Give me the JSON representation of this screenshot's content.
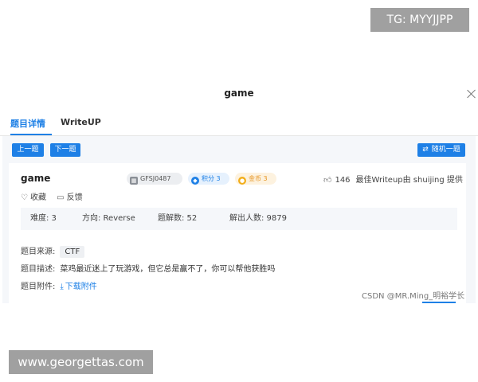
{
  "watermarks": {
    "top_right": "TG: MYYJJPP",
    "bottom_left": "www.georgettas.com",
    "csdn": "CSDN @MR.Ming_明裕学长"
  },
  "modal": {
    "title": "game"
  },
  "tabs": [
    {
      "label": "题目详情",
      "active": true
    },
    {
      "label": "WriteUP",
      "active": false
    }
  ],
  "toolbar": {
    "prev_label": "上一题",
    "next_label": "下一题",
    "random_label": "随机一题"
  },
  "challenge": {
    "name": "game",
    "id_badge": "GFSJ0487",
    "points_badge": "积分 3",
    "gold_badge": "金币 3",
    "likes": "146",
    "best_writeup": "最佳Writeup由 shuijing 提供",
    "favorite_label": "收藏",
    "feedback_label": "反馈",
    "stats": {
      "difficulty": "难度:  3",
      "direction": "方向:  Reverse",
      "solves": "题解数:  52",
      "solvers": "解出人数:  9879"
    },
    "source_label": "题目来源:",
    "source_tag": "CTF",
    "description_label": "题目描述:",
    "description": "菜鸡最近迷上了玩游戏，但它总是赢不了，你可以帮他获胜吗",
    "attachment_label": "题目附件:",
    "download_label": "下载附件"
  },
  "colors": {
    "accent": "#1e80e6",
    "gold": "#e69422",
    "panel_bg": "#f5f7fa"
  },
  "icons": [
    "close-icon",
    "shuffle-icon",
    "thumb-up-icon",
    "heart-icon",
    "chat-icon",
    "download-icon"
  ]
}
